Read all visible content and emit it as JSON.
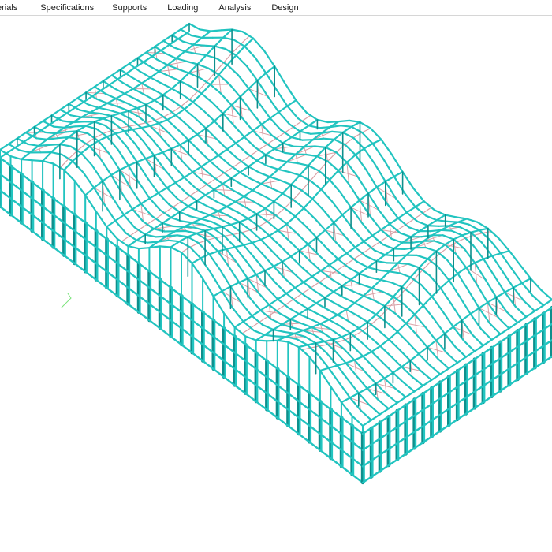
{
  "menu": {
    "items": [
      {
        "label": "erials"
      },
      {
        "label": "Specifications"
      },
      {
        "label": "Supports"
      },
      {
        "label": "Loading"
      },
      {
        "label": "Analysis"
      },
      {
        "label": "Design"
      }
    ]
  },
  "colors": {
    "member": "#22c4c0",
    "member_dark": "#0e8f8c",
    "bracing": "#d9a0a6",
    "axis": "#7be37b",
    "background": "#ffffff"
  }
}
